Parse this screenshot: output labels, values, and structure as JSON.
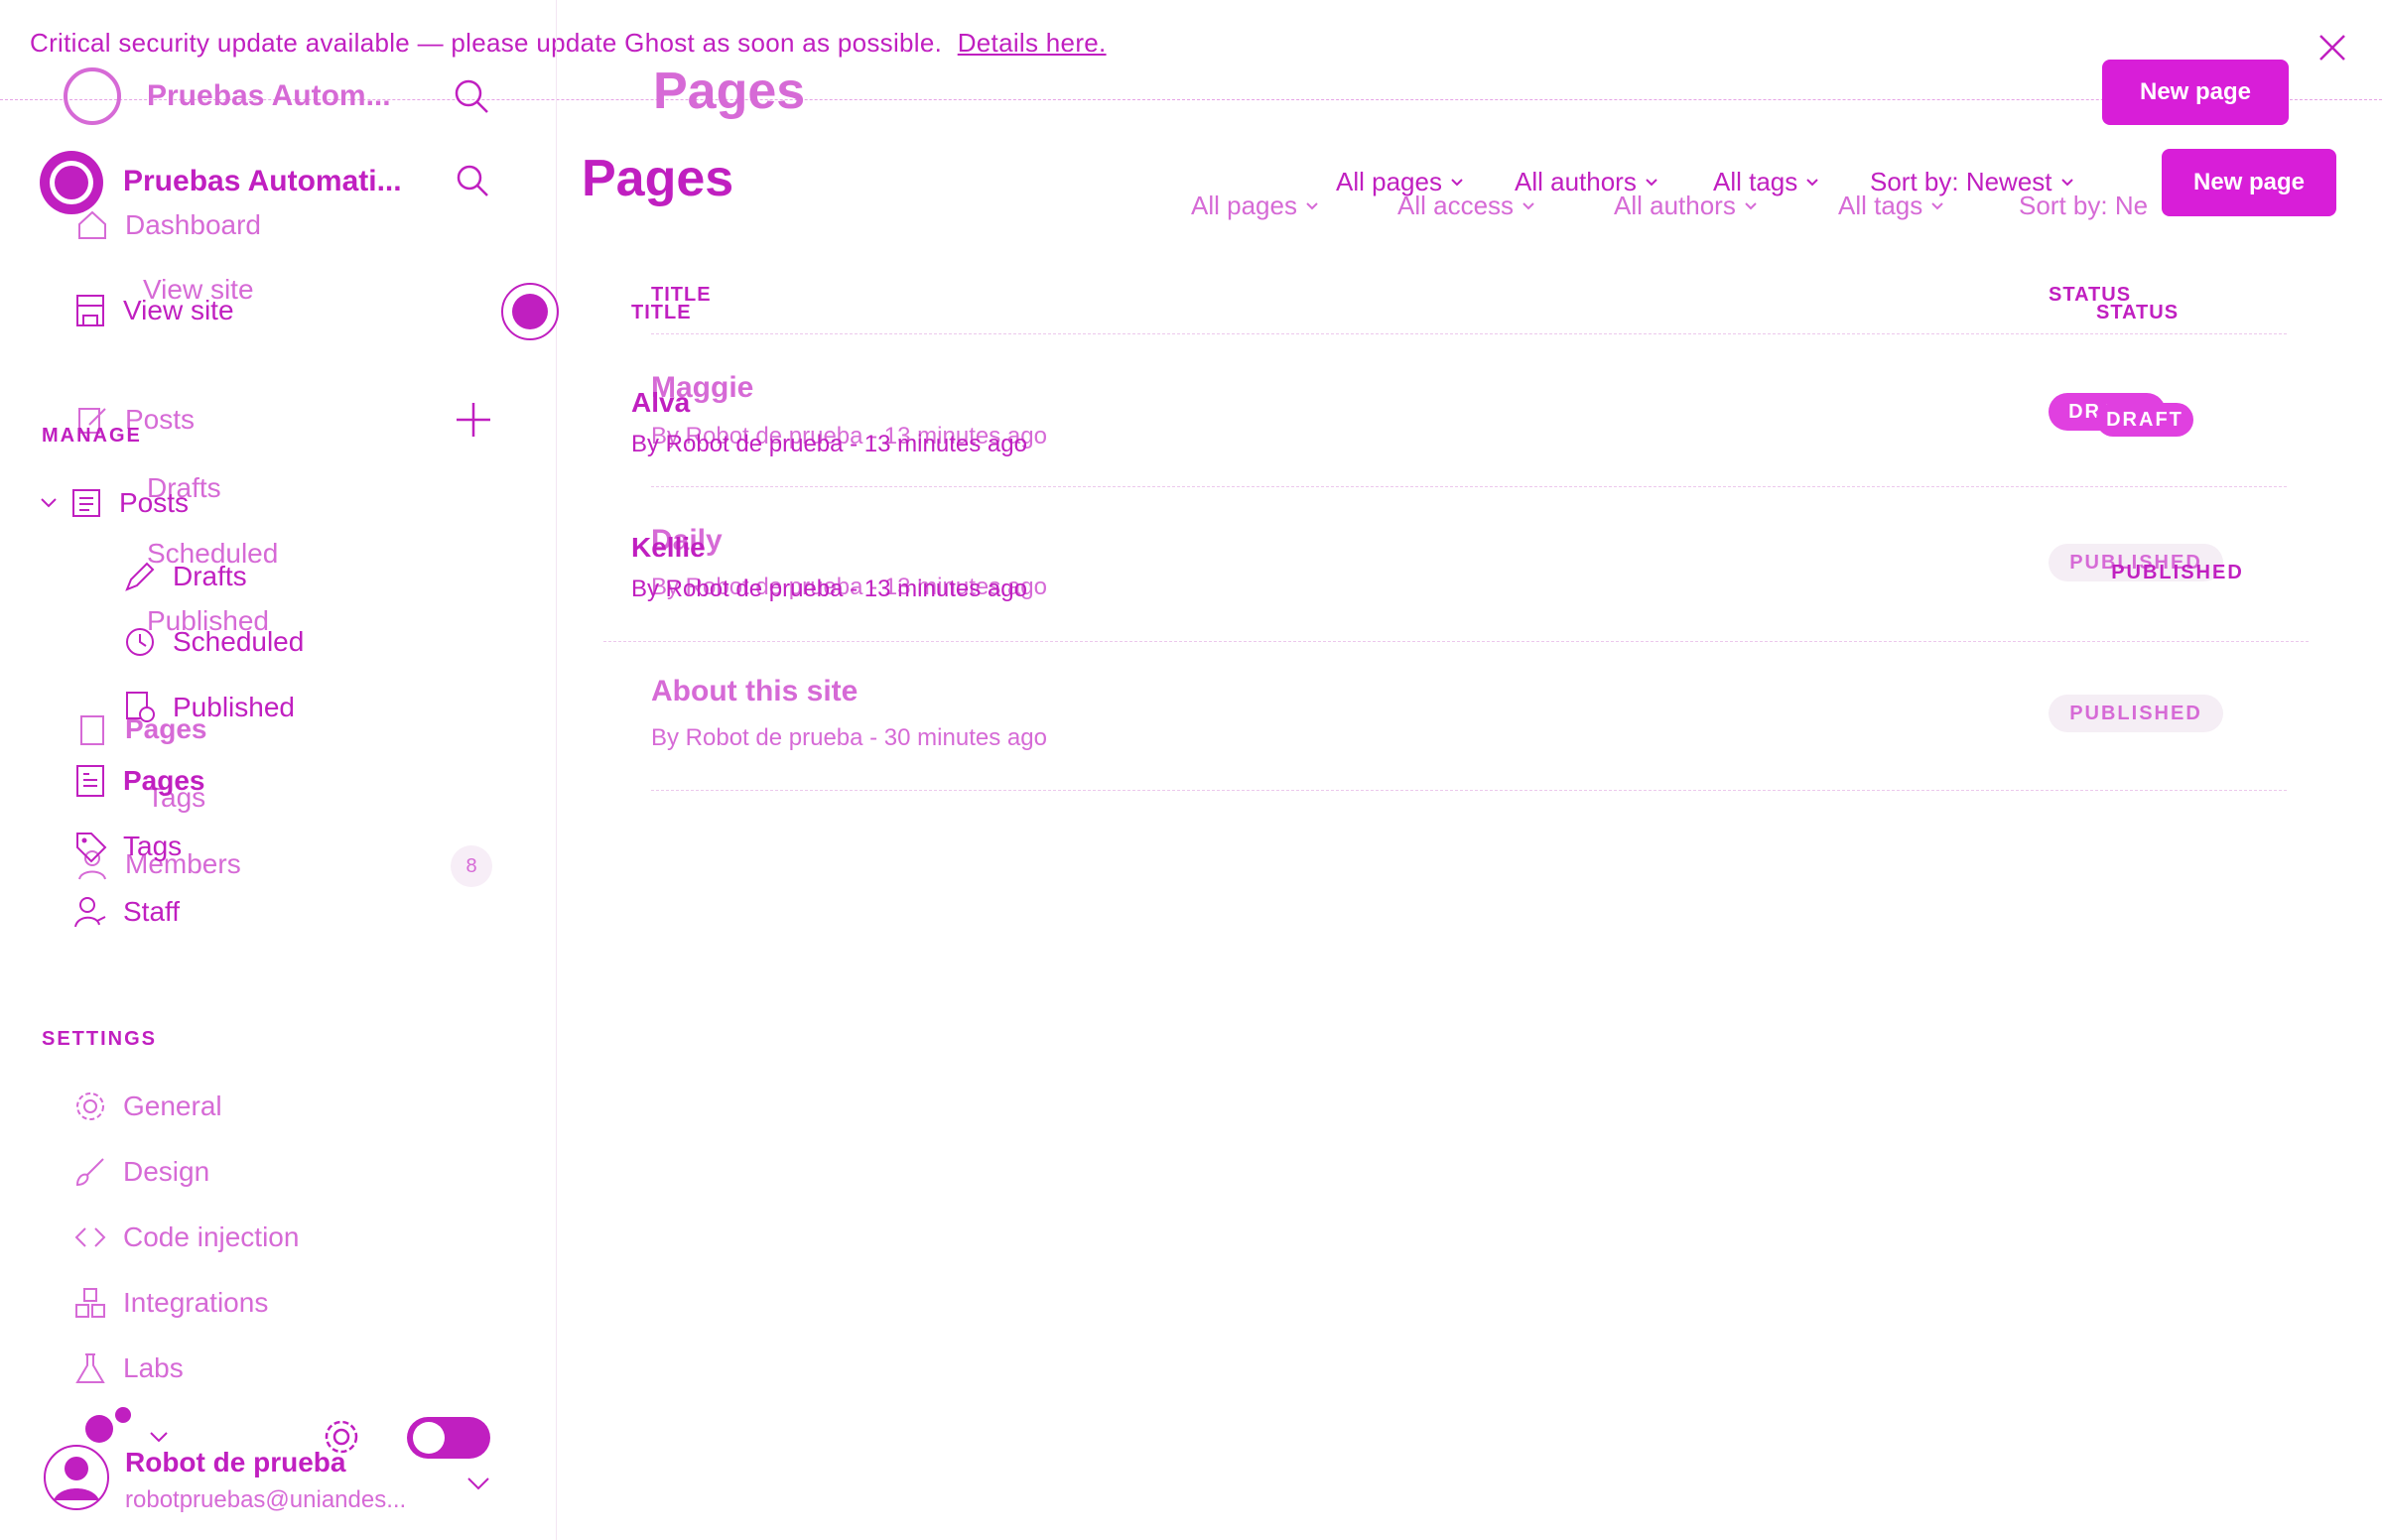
{
  "banner": {
    "message": "Critical security update available — please update Ghost as soon as possible.",
    "link": "Details here."
  },
  "sidebar": {
    "site_name_overlay": "Pruebas Autom...",
    "site_name": "Pruebas Automati...",
    "overlay_items": {
      "dashboard": "Dashboard",
      "view_site": "View site",
      "posts": "Posts",
      "drafts": "Drafts",
      "scheduled": "Scheduled",
      "published": "Published",
      "pages": "Pages",
      "tags": "Tags",
      "members": "Members",
      "members_count": "8"
    },
    "view_site": "View site",
    "manage_label": "MANAGE",
    "posts": "Posts",
    "drafts": "Drafts",
    "scheduled": "Scheduled",
    "published": "Published",
    "pages": "Pages",
    "tags": "Tags",
    "staff": "Staff",
    "settings_label": "SETTINGS",
    "settings_items": {
      "general": "General",
      "design": "Design",
      "code_injection": "Code injection",
      "integrations": "Integrations",
      "labs": "Labs"
    },
    "user": {
      "name": "Robot de prueba",
      "email": "robotpruebas@uniandes..."
    }
  },
  "main": {
    "title_overlay": "Pages",
    "title": "Pages",
    "new_page_label": "New page",
    "filters_top": {
      "pages": "All pages",
      "authors": "All authors",
      "tags": "All tags",
      "sort": "Sort by: Newest"
    },
    "filters_bottom": {
      "pages": "All pages",
      "access": "All access",
      "authors": "All authors",
      "tags": "All tags",
      "sort": "Sort by: Ne"
    },
    "columns": {
      "title": "TITLE",
      "status": "STATUS"
    },
    "rows_overlay": [
      {
        "title": "Maggie",
        "meta": "By Robot de prueba - 13 minutes ago",
        "status": "DRAFT"
      },
      {
        "title": "Daily",
        "meta": "By Robot de prueba - 13 minutes ago",
        "status": "PUBLISHED"
      },
      {
        "title": "About this site",
        "meta": "By Robot de prueba - 30 minutes ago",
        "status": "PUBLISHED"
      }
    ],
    "rows": [
      {
        "title": "Alva",
        "meta": "By Robot de prueba - 13 minutes ago",
        "status": "DRAFT"
      },
      {
        "title": "Kellie",
        "meta": "By Robot de prueba - 13 minutes ago",
        "status": "PUBLISHED"
      }
    ]
  },
  "colors": {
    "accent": "#c01fc0",
    "button": "#d81ed8",
    "background": "#ffffff"
  }
}
